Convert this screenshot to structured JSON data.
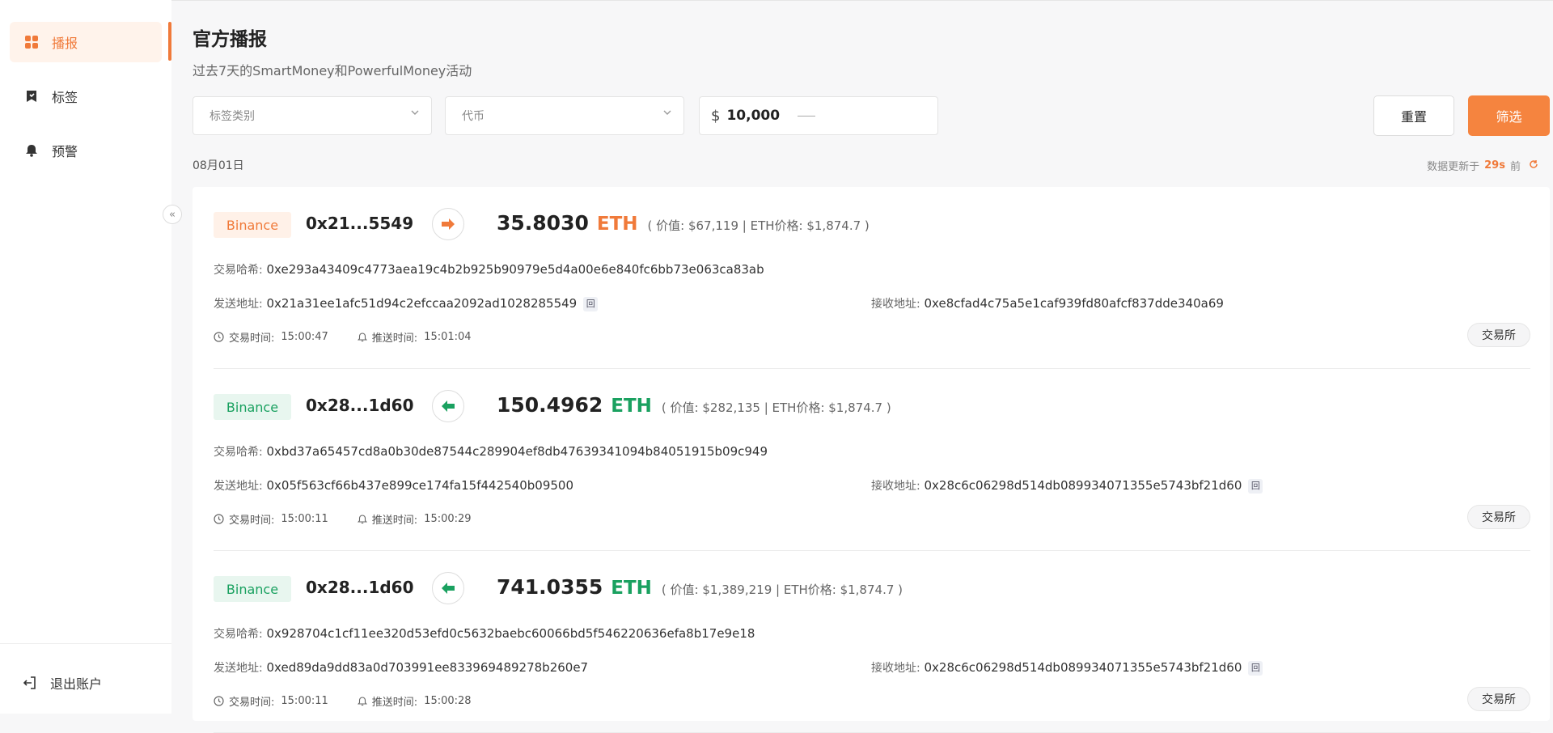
{
  "sidebar": {
    "items": [
      {
        "label": "播报",
        "icon": "grid-icon",
        "active": true
      },
      {
        "label": "标签",
        "icon": "bookmark-icon",
        "active": false
      },
      {
        "label": "预警",
        "icon": "bell-icon",
        "active": false
      }
    ],
    "logout_label": "退出账户",
    "collapse_glyph": "«"
  },
  "header": {
    "title": "官方播报",
    "subtitle": "过去7天的SmartMoney和PowerfulMoney活动"
  },
  "filters": {
    "tag_category_placeholder": "标签类别",
    "token_placeholder": "代币",
    "currency_symbol": "$",
    "amount_value": "10,000",
    "reset_label": "重置",
    "filter_label": "筛选"
  },
  "feed": {
    "date": "08月01日",
    "updated_prefix": "数据更新于",
    "updated_seconds": "29s",
    "updated_suffix": "前",
    "labels": {
      "tx_hash": "交易哈希:",
      "from": "发送地址:",
      "to": "接收地址:",
      "tx_time": "交易时间:",
      "push_time": "推送时间:",
      "copy_glyph": "回"
    },
    "accent_out": "#f07a3a",
    "accent_in": "#1aa160",
    "cards": [
      {
        "exchange": "Binance",
        "direction": "out",
        "address_short": "0x21...5549",
        "amount": "35.8030",
        "symbol": "ETH",
        "meta": "( 价值: $67,119  |  ETH价格: $1,874.7 )",
        "tx_hash": "0xe293a43409c4773aea19c4b2b925b90979e5d4a00e6e840fc6bb73e063ca83ab",
        "from": "0x21a31ee1afc51d94c2efccaa2092ad1028285549",
        "to": "0xe8cfad4c75a5e1caf939fd80afcf837dde340a69",
        "copy_on": "from",
        "tx_time": "15:00:47",
        "push_time": "15:01:04",
        "badge": "交易所"
      },
      {
        "exchange": "Binance",
        "direction": "in",
        "address_short": "0x28...1d60",
        "amount": "150.4962",
        "symbol": "ETH",
        "meta": "( 价值: $282,135  |  ETH价格: $1,874.7 )",
        "tx_hash": "0xbd37a65457cd8a0b30de87544c289904ef8db47639341094b84051915b09c949",
        "from": "0x05f563cf66b437e899ce174fa15f442540b09500",
        "to": "0x28c6c06298d514db089934071355e5743bf21d60",
        "copy_on": "to",
        "tx_time": "15:00:11",
        "push_time": "15:00:29",
        "badge": "交易所"
      },
      {
        "exchange": "Binance",
        "direction": "in",
        "address_short": "0x28...1d60",
        "amount": "741.0355",
        "symbol": "ETH",
        "meta": "( 价值: $1,389,219  |  ETH价格: $1,874.7 )",
        "tx_hash": "0x928704c1cf11ee320d53efd0c5632baebc60066bd5f546220636efa8b17e9e18",
        "from": "0xed89da9dd83a0d703991ee833969489278b260e7",
        "to": "0x28c6c06298d514db089934071355e5743bf21d60",
        "copy_on": "to",
        "tx_time": "15:00:11",
        "push_time": "15:00:28",
        "badge": "交易所"
      }
    ]
  }
}
